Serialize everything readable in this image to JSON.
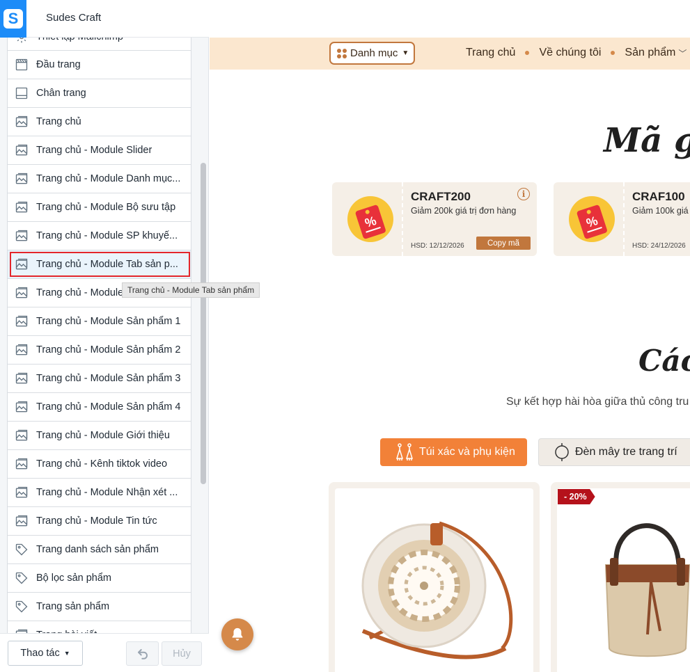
{
  "app": {
    "store_name": "Sudes Craft",
    "logo_letter": "S"
  },
  "sidebar": {
    "items": [
      {
        "label": "Thiết lập Mailchimp",
        "icon": "gear-icon"
      },
      {
        "label": "Đầu trang",
        "icon": "header-layout-icon"
      },
      {
        "label": "Chân trang",
        "icon": "footer-layout-icon"
      },
      {
        "label": "Trang chủ",
        "icon": "image-icon"
      },
      {
        "label": "Trang chủ - Module Slider",
        "icon": "image-icon"
      },
      {
        "label": "Trang chủ - Module Danh mục...",
        "icon": "image-icon"
      },
      {
        "label": "Trang chủ - Module Bộ sưu tập",
        "icon": "image-icon"
      },
      {
        "label": "Trang chủ - Module SP khuyế...",
        "icon": "image-icon"
      },
      {
        "label": "Trang chủ - Module Tab sản p...",
        "icon": "image-icon",
        "selected": true
      },
      {
        "label": "Trang chủ - Module",
        "icon": "image-icon"
      },
      {
        "label": "Trang chủ - Module Sản phẩm 1",
        "icon": "image-icon"
      },
      {
        "label": "Trang chủ - Module Sản phẩm 2",
        "icon": "image-icon"
      },
      {
        "label": "Trang chủ - Module Sản phẩm 3",
        "icon": "image-icon"
      },
      {
        "label": "Trang chủ - Module Sản phẩm 4",
        "icon": "image-icon"
      },
      {
        "label": "Trang chủ - Module Giới thiệu",
        "icon": "image-icon"
      },
      {
        "label": "Trang chủ - Kênh tiktok video",
        "icon": "image-icon"
      },
      {
        "label": "Trang chủ - Module Nhận xét ...",
        "icon": "image-icon"
      },
      {
        "label": "Trang chủ - Module Tin tức",
        "icon": "image-icon"
      },
      {
        "label": "Trang danh sách sản phẩm",
        "icon": "tag-icon"
      },
      {
        "label": "Bộ lọc sản phẩm",
        "icon": "tag-icon"
      },
      {
        "label": "Trang sản phẩm",
        "icon": "tag-icon"
      },
      {
        "label": "Trang bài viết",
        "icon": "image-icon"
      }
    ],
    "tooltip": "Trang chủ - Module Tab sản phẩm",
    "footer": {
      "actions_label": "Thao tác",
      "cancel_label": "Hủy"
    }
  },
  "preview": {
    "category_button": "Danh mục",
    "menu": [
      {
        "label": "Trang chủ"
      },
      {
        "label": "Về chúng tôi"
      },
      {
        "label": "Sản phẩm",
        "has_dropdown": true
      }
    ],
    "coupon_heading": "Mã gi",
    "coupons": [
      {
        "code": "CRAFT200",
        "desc": "Giảm 200k giá trị đơn hàng",
        "expiry": "HSD: 12/12/2026",
        "copy_label": "Copy mã"
      },
      {
        "code": "CRAF100",
        "desc": "Giảm 100k giá",
        "expiry": "HSD: 24/12/2026"
      }
    ],
    "product_heading": "Các",
    "product_subtitle": "Sự kết hợp hài hòa giữa thủ công tru",
    "tabs": [
      {
        "label": "Túi xác và phụ kiện",
        "active": true
      },
      {
        "label": "Đèn mây tre trang trí",
        "active": false
      }
    ],
    "products": [
      {
        "badge": ""
      },
      {
        "badge": "- 20%"
      }
    ]
  },
  "colors": {
    "accent": "#1d8cf8",
    "brand_brown": "#c1773d",
    "tab_orange": "#f28138",
    "selection_red": "#e3262b",
    "nav_bg": "#fbe7cf"
  }
}
